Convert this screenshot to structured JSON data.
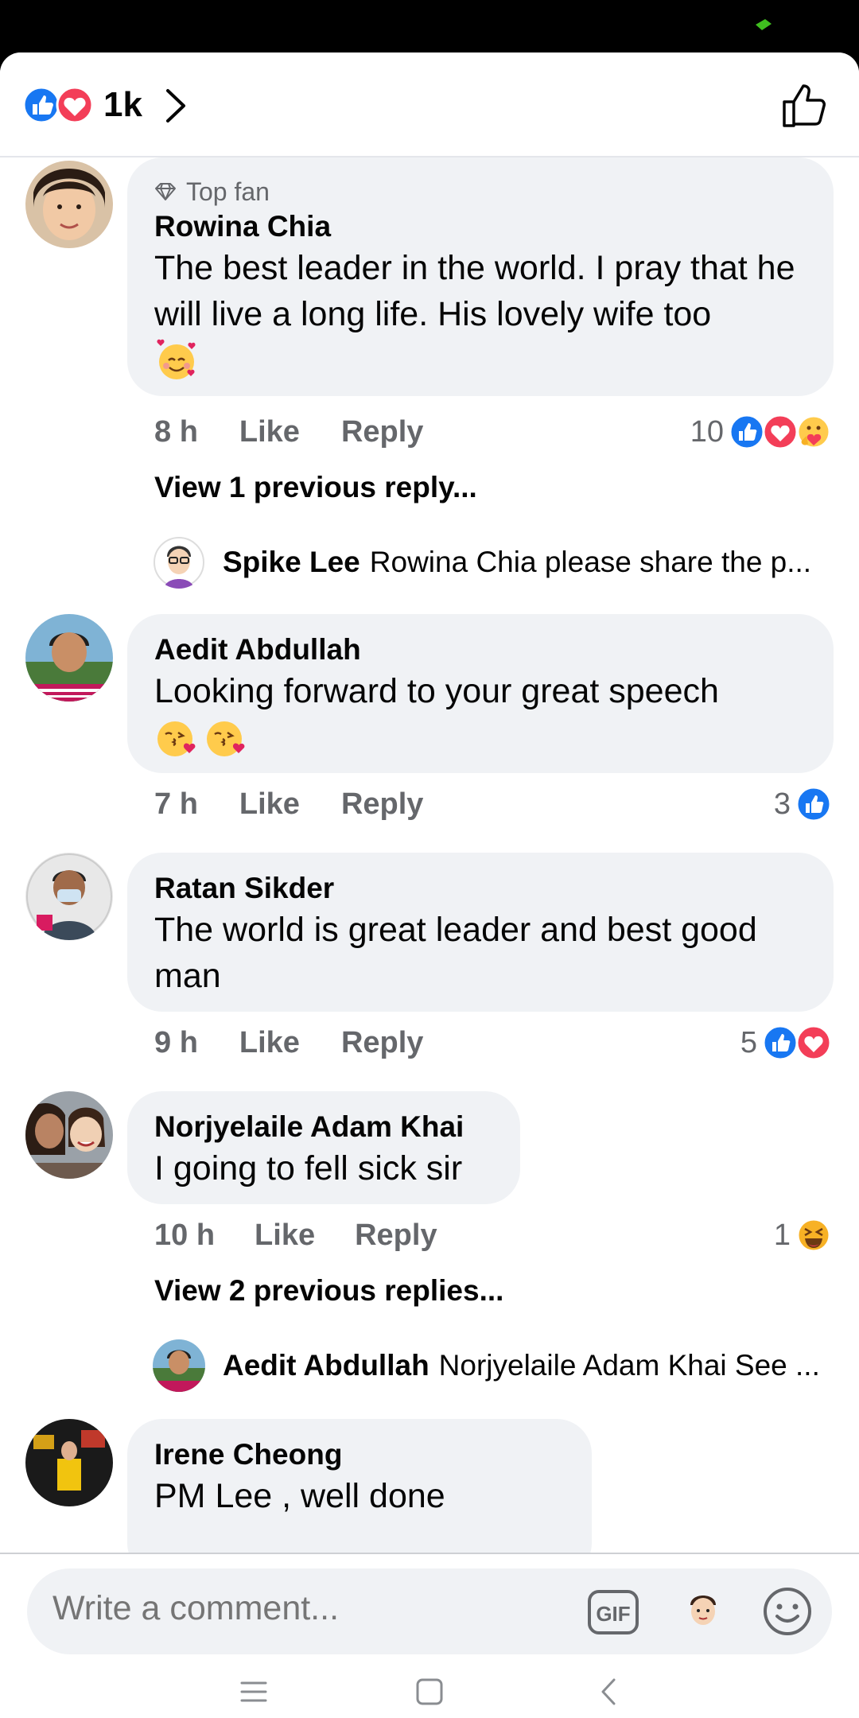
{
  "header": {
    "reaction_count": "1k"
  },
  "comments": [
    {
      "badge": "Top fan",
      "author": "Rowina Chia",
      "text": "The best leader in the world. I pray that he will live a long life. His lovely wife too",
      "time": "8 h",
      "like": "Like",
      "reply": "Reply",
      "reaction_count": "10",
      "view_replies": "View 1 previous reply...",
      "reply_preview": {
        "author": "Spike Lee",
        "text": "Rowina Chia please share the p..."
      }
    },
    {
      "author": "Aedit Abdullah",
      "text": "Looking forward to your great speech",
      "time": "7 h",
      "like": "Like",
      "reply": "Reply",
      "reaction_count": "3"
    },
    {
      "author": "Ratan Sikder",
      "text": "The world is great leader and best good man",
      "time": "9 h",
      "like": "Like",
      "reply": "Reply",
      "reaction_count": "5"
    },
    {
      "author": "Norjyelaile Adam Khai",
      "text": "I going to fell sick sir",
      "time": "10 h",
      "like": "Like",
      "reply": "Reply",
      "reaction_count": "1",
      "view_replies": "View 2 previous replies...",
      "reply_preview": {
        "author": "Aedit Abdullah",
        "text": "Norjyelaile Adam Khai See ..."
      }
    },
    {
      "author": "Irene Cheong",
      "text": "PM Lee , well done"
    }
  ],
  "composer": {
    "placeholder": "Write a comment...",
    "gif_label": "GIF"
  },
  "colors": {
    "like_blue": "#1877f2",
    "love_red": "#f33e58",
    "bubble": "#f0f2f5",
    "meta_gray": "#65676b"
  }
}
